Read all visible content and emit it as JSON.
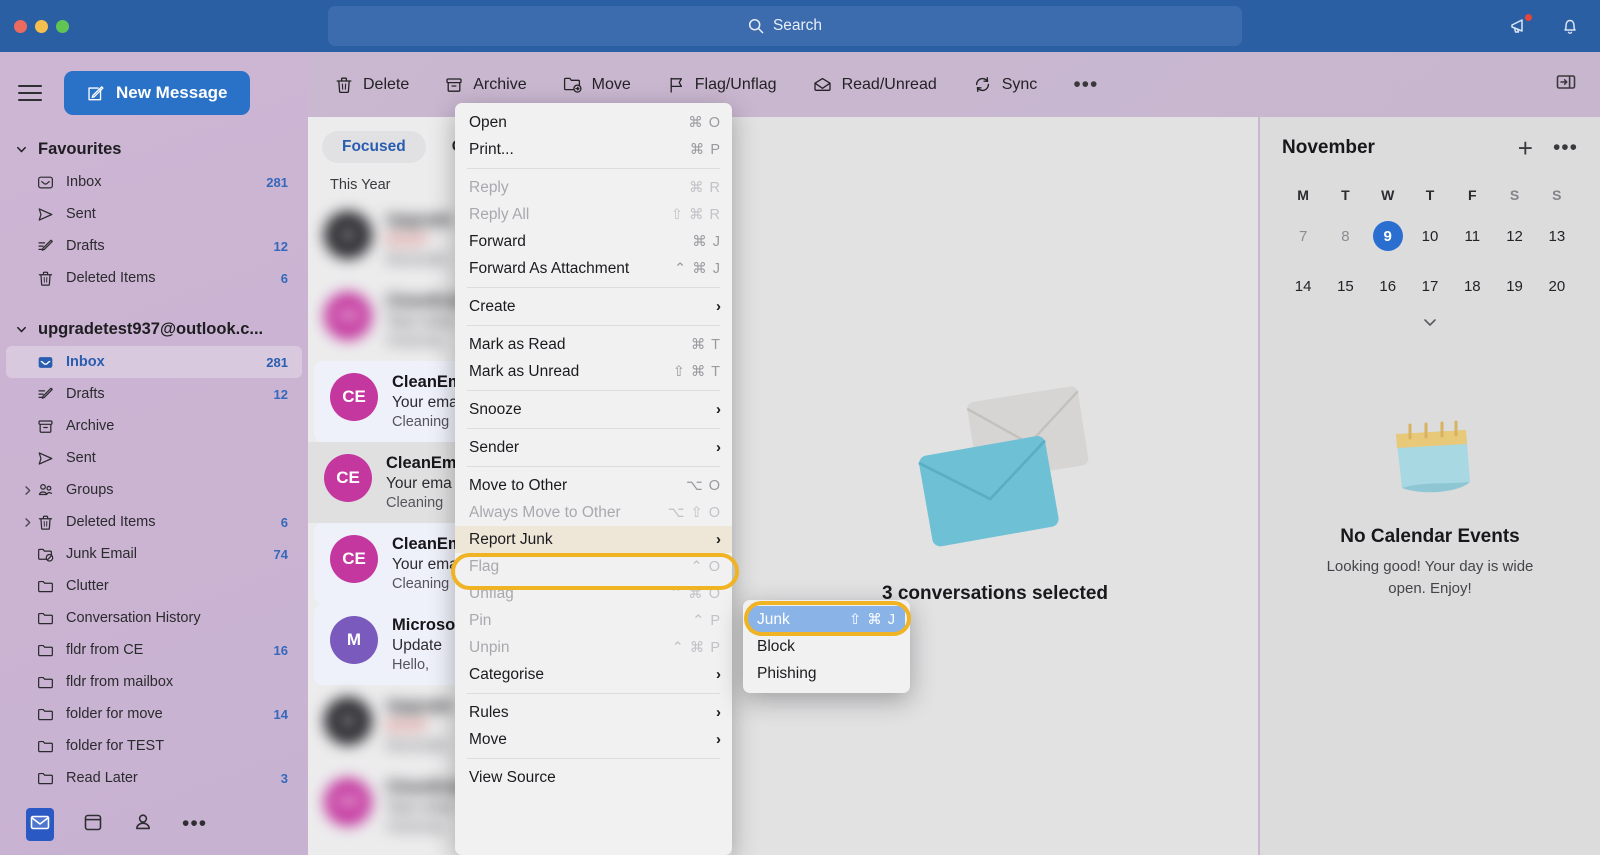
{
  "titlebar": {
    "search_placeholder": "Search",
    "icons": [
      {
        "name": "megaphone-icon",
        "has_badge": true
      },
      {
        "name": "bell-icon",
        "has_badge": false
      }
    ]
  },
  "toolbar": {
    "buttons": [
      {
        "label": "Delete",
        "icon": "trash-icon"
      },
      {
        "label": "Archive",
        "icon": "archive-icon"
      },
      {
        "label": "Move",
        "icon": "move-folder-icon"
      },
      {
        "label": "Flag/Unflag",
        "icon": "flag-icon"
      },
      {
        "label": "Read/Unread",
        "icon": "envelope-open-icon"
      },
      {
        "label": "Sync",
        "icon": "sync-icon"
      }
    ],
    "overflow_label": "•••",
    "right_panel_toggle": "panel-toggle-icon"
  },
  "sidebar": {
    "new_message_label": "New Message",
    "favourites": {
      "title": "Favourites",
      "items": [
        {
          "label": "Inbox",
          "count": "281",
          "icon": "inbox-icon"
        },
        {
          "label": "Sent",
          "count": "",
          "icon": "sent-icon"
        },
        {
          "label": "Drafts",
          "count": "12",
          "icon": "drafts-icon"
        },
        {
          "label": "Deleted Items",
          "count": "6",
          "icon": "trash-icon"
        }
      ]
    },
    "account": {
      "title": "upgradetest937@outlook.c...",
      "items": [
        {
          "label": "Inbox",
          "count": "281",
          "icon": "inbox-icon",
          "selected": true,
          "expandable": false
        },
        {
          "label": "Drafts",
          "count": "12",
          "icon": "drafts-icon",
          "selected": false,
          "expandable": false
        },
        {
          "label": "Archive",
          "count": "",
          "icon": "archive-icon",
          "selected": false,
          "expandable": false
        },
        {
          "label": "Sent",
          "count": "",
          "icon": "sent-icon",
          "selected": false,
          "expandable": false
        },
        {
          "label": "Groups",
          "count": "",
          "icon": "groups-icon",
          "selected": false,
          "expandable": true
        },
        {
          "label": "Deleted Items",
          "count": "6",
          "icon": "trash-icon",
          "selected": false,
          "expandable": true
        },
        {
          "label": "Junk Email",
          "count": "74",
          "icon": "junk-folder-icon",
          "selected": false,
          "expandable": false
        },
        {
          "label": "Clutter",
          "count": "",
          "icon": "folder-icon",
          "selected": false,
          "expandable": false
        },
        {
          "label": "Conversation History",
          "count": "",
          "icon": "folder-icon",
          "selected": false,
          "expandable": false
        },
        {
          "label": "fldr from CE",
          "count": "16",
          "icon": "folder-icon",
          "selected": false,
          "expandable": false
        },
        {
          "label": "fldr from mailbox",
          "count": "",
          "icon": "folder-icon",
          "selected": false,
          "expandable": false
        },
        {
          "label": "folder for move",
          "count": "14",
          "icon": "folder-icon",
          "selected": false,
          "expandable": false
        },
        {
          "label": "folder for TEST",
          "count": "",
          "icon": "folder-icon",
          "selected": false,
          "expandable": false
        },
        {
          "label": "Read Later",
          "count": "3",
          "icon": "folder-icon",
          "selected": false,
          "expandable": false
        }
      ]
    },
    "bottom_nav": [
      {
        "name": "mail-nav-icon",
        "active": true
      },
      {
        "name": "calendar-nav-icon",
        "active": false
      },
      {
        "name": "people-nav-icon",
        "active": false
      },
      {
        "name": "more-nav-icon",
        "active": false
      }
    ]
  },
  "message_list": {
    "pivots": [
      {
        "label": "Focused",
        "active": true
      },
      {
        "label": "Other",
        "active": false
      }
    ],
    "group_label": "This Year",
    "messages": [
      {
        "from": "Upgrade",
        "subject": "RSVP",
        "preview": "Reminder",
        "initials": "U",
        "color": "#2e2d31",
        "state": "blurred"
      },
      {
        "from": "CleanEmail",
        "subject": "Your ema",
        "preview": "Cleaning",
        "initials": "CE",
        "color": "#c4379f",
        "state": "blurred"
      },
      {
        "from": "CleanEmail",
        "subject": "Your ema",
        "preview": "Cleaning",
        "initials": "CE",
        "color": "#c4379f",
        "state": "selected"
      },
      {
        "from": "CleanEmail",
        "subject": "Your ema",
        "preview": "Cleaning",
        "initials": "CE",
        "color": "#c4379f",
        "state": "hover-dim"
      },
      {
        "from": "CleanEmail",
        "subject": "Your ema",
        "preview": "Cleaning",
        "initials": "CE",
        "color": "#c4379f",
        "state": "selected"
      },
      {
        "from": "Microsoft",
        "subject": "Update",
        "preview": "Hello,",
        "initials": "M",
        "color": "#7a5bbd",
        "state": "selected"
      },
      {
        "from": "Upgrade",
        "subject": "RSVP",
        "preview": "Reminder",
        "initials": "U",
        "color": "#2e2d31",
        "state": "blurred"
      },
      {
        "from": "CleanEmail",
        "subject": "Your ema",
        "preview": "Cleaning",
        "initials": "CE",
        "color": "#c4379f",
        "state": "blurred"
      }
    ]
  },
  "reading_pane": {
    "status": "3 conversations selected"
  },
  "calendar": {
    "month": "November",
    "add_label": "+",
    "more_label": "•••",
    "dow": [
      "M",
      "T",
      "W",
      "T",
      "F",
      "S",
      "S"
    ],
    "weeks": [
      [
        {
          "d": "7",
          "other": true,
          "today": false
        },
        {
          "d": "8",
          "other": true,
          "today": false
        },
        {
          "d": "9",
          "other": false,
          "today": true
        },
        {
          "d": "10",
          "other": false,
          "today": false
        },
        {
          "d": "11",
          "other": false,
          "today": false
        },
        {
          "d": "12",
          "other": false,
          "today": false
        },
        {
          "d": "13",
          "other": false,
          "today": false
        }
      ],
      [
        {
          "d": "14",
          "other": false,
          "today": false
        },
        {
          "d": "15",
          "other": false,
          "today": false
        },
        {
          "d": "16",
          "other": false,
          "today": false
        },
        {
          "d": "17",
          "other": false,
          "today": false
        },
        {
          "d": "18",
          "other": false,
          "today": false
        },
        {
          "d": "19",
          "other": false,
          "today": false
        },
        {
          "d": "20",
          "other": false,
          "today": false
        }
      ]
    ],
    "empty_title": "No Calendar Events",
    "empty_sub": "Looking good! Your day is wide open. Enjoy!"
  },
  "context_menu": {
    "items": [
      {
        "type": "item",
        "label": "Open",
        "key": "⌘ O",
        "disabled": false,
        "arrow": false
      },
      {
        "type": "item",
        "label": "Print...",
        "key": "⌘ P",
        "disabled": false,
        "arrow": false
      },
      {
        "type": "sep"
      },
      {
        "type": "item",
        "label": "Reply",
        "key": "⌘ R",
        "disabled": true,
        "arrow": false
      },
      {
        "type": "item",
        "label": "Reply All",
        "key": "⇧ ⌘ R",
        "disabled": true,
        "arrow": false
      },
      {
        "type": "item",
        "label": "Forward",
        "key": "⌘ J",
        "disabled": false,
        "arrow": false
      },
      {
        "type": "item",
        "label": "Forward As Attachment",
        "key": "⌃ ⌘ J",
        "disabled": false,
        "arrow": false
      },
      {
        "type": "sep"
      },
      {
        "type": "item",
        "label": "Create",
        "key": "",
        "disabled": false,
        "arrow": true
      },
      {
        "type": "sep"
      },
      {
        "type": "item",
        "label": "Mark as Read",
        "key": "⌘ T",
        "disabled": false,
        "arrow": false
      },
      {
        "type": "item",
        "label": "Mark as Unread",
        "key": "⇧ ⌘ T",
        "disabled": false,
        "arrow": false
      },
      {
        "type": "sep"
      },
      {
        "type": "item",
        "label": "Snooze",
        "key": "",
        "disabled": false,
        "arrow": true
      },
      {
        "type": "sep"
      },
      {
        "type": "item",
        "label": "Sender",
        "key": "",
        "disabled": false,
        "arrow": true
      },
      {
        "type": "sep"
      },
      {
        "type": "item",
        "label": "Move to Other",
        "key": "⌥ O",
        "disabled": false,
        "arrow": false
      },
      {
        "type": "item",
        "label": "Always Move to Other",
        "key": "⌥ ⇧ O",
        "disabled": true,
        "arrow": false
      },
      {
        "type": "item",
        "label": "Report Junk",
        "key": "",
        "disabled": false,
        "arrow": true,
        "highlighted": true
      },
      {
        "type": "item",
        "label": "Flag",
        "key": "⌃ O",
        "disabled": true,
        "arrow": false
      },
      {
        "type": "item",
        "label": "Unflag",
        "key": "⌃ ⌘ O",
        "disabled": true,
        "arrow": false
      },
      {
        "type": "item",
        "label": "Pin",
        "key": "⌃ P",
        "disabled": true,
        "arrow": false
      },
      {
        "type": "item",
        "label": "Unpin",
        "key": "⌃ ⌘ P",
        "disabled": true,
        "arrow": false
      },
      {
        "type": "item",
        "label": "Categorise",
        "key": "",
        "disabled": false,
        "arrow": true
      },
      {
        "type": "sep"
      },
      {
        "type": "item",
        "label": "Rules",
        "key": "",
        "disabled": false,
        "arrow": true
      },
      {
        "type": "item",
        "label": "Move",
        "key": "",
        "disabled": false,
        "arrow": true
      },
      {
        "type": "sep"
      },
      {
        "type": "item",
        "label": "View Source",
        "key": "",
        "disabled": false,
        "arrow": false
      }
    ]
  },
  "submenu": {
    "items": [
      {
        "label": "Junk",
        "key": "⇧ ⌘ J",
        "selected": true
      },
      {
        "label": "Block",
        "key": "",
        "selected": false
      },
      {
        "label": "Phishing",
        "key": "",
        "selected": false
      }
    ]
  },
  "colors": {
    "titlebar": "#2b5fa4",
    "accent": "#2a72c8",
    "highlight_ring": "#f0b323",
    "submenu_selected": "#8ab4e8",
    "sidebar_bg": "#cdb6d4"
  }
}
